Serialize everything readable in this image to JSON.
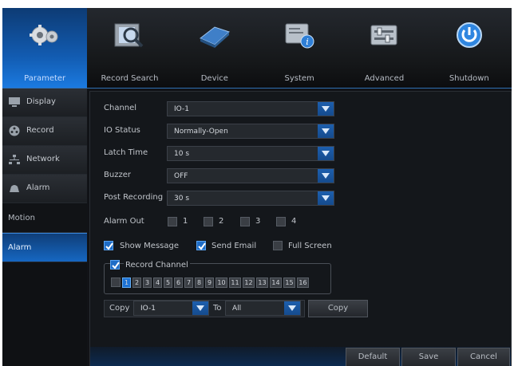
{
  "nav": {
    "tabs": [
      {
        "label": "Parameter",
        "icon": "gears-icon",
        "active": true
      },
      {
        "label": "Record Search",
        "icon": "film-magnifier-icon",
        "active": false
      },
      {
        "label": "Device",
        "icon": "hard-drive-icon",
        "active": false
      },
      {
        "label": "System",
        "icon": "system-info-icon",
        "active": false
      },
      {
        "label": "Advanced",
        "icon": "sliders-icon",
        "active": false
      },
      {
        "label": "Shutdown",
        "icon": "power-icon",
        "active": false
      }
    ]
  },
  "sidebar": {
    "items": [
      {
        "label": "Display",
        "icon": "monitor-icon"
      },
      {
        "label": "Record",
        "icon": "film-reel-icon"
      },
      {
        "label": "Network",
        "icon": "network-icon"
      },
      {
        "label": "Alarm",
        "icon": "alarm-bell-icon"
      }
    ],
    "subitems": [
      {
        "label": "Motion",
        "selected": false
      },
      {
        "label": "Alarm",
        "selected": true
      }
    ]
  },
  "form": {
    "channel": {
      "label": "Channel",
      "value": "IO-1"
    },
    "io_status": {
      "label": "IO Status",
      "value": "Normally-Open"
    },
    "latch_time": {
      "label": "Latch Time",
      "value": "10 s"
    },
    "buzzer": {
      "label": "Buzzer",
      "value": "OFF"
    },
    "post_recording": {
      "label": "Post Recording",
      "value": "30 s"
    },
    "alarm_out": {
      "label": "Alarm Out",
      "options": [
        "1",
        "2",
        "3",
        "4"
      ],
      "checked": [
        false,
        false,
        false,
        false
      ]
    },
    "show_message": {
      "label": "Show Message",
      "checked": true
    },
    "send_email": {
      "label": "Send Email",
      "checked": true
    },
    "full_screen": {
      "label": "Full Screen",
      "checked": false
    },
    "record_channel": {
      "label": "Record Channel",
      "checked": true,
      "channels": [
        "1",
        "2",
        "3",
        "4",
        "5",
        "6",
        "7",
        "8",
        "9",
        "10",
        "11",
        "12",
        "13",
        "14",
        "15",
        "16"
      ],
      "selected": [
        "1"
      ]
    }
  },
  "copy": {
    "label": "Copy",
    "from": "IO-1",
    "to_label": "To",
    "to": "All",
    "button": "Copy"
  },
  "buttons": {
    "default": "Default",
    "save": "Save",
    "cancel": "Cancel"
  },
  "colors": {
    "accent": "#1d6fd0",
    "background": "#111317"
  }
}
